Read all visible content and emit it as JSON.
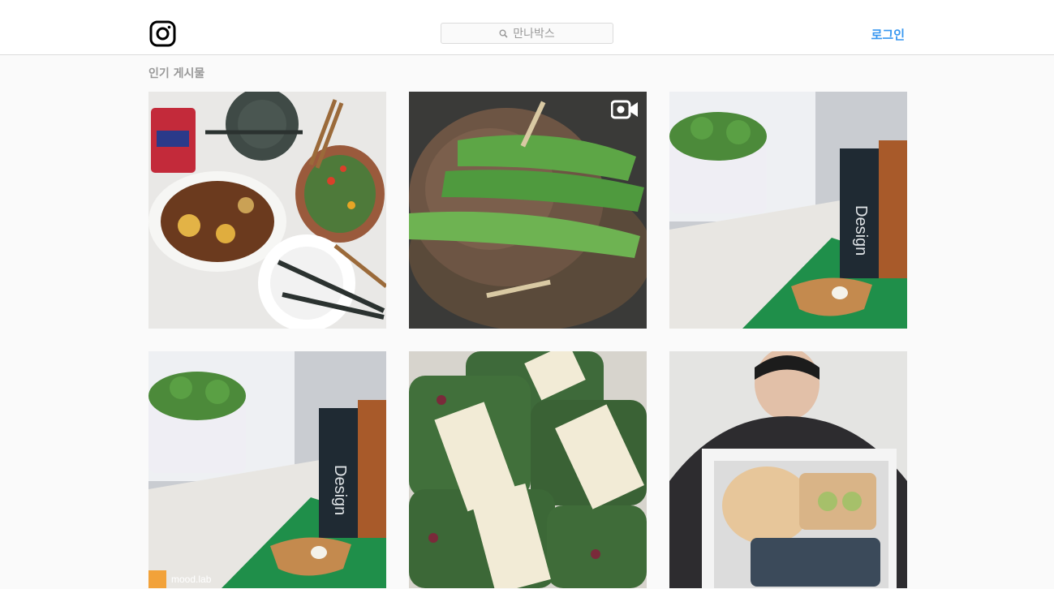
{
  "header": {
    "logo_icon": "instagram-camera-icon",
    "search_placeholder": "만나박스",
    "login_label": "로그인"
  },
  "main": {
    "section_title": "인기 게시물",
    "posts": [
      {
        "kind": "photo",
        "subject": "food-plates"
      },
      {
        "kind": "video",
        "subject": "steak-asparagus",
        "icon": "video-camera-icon"
      },
      {
        "kind": "photo",
        "subject": "planter-design-book"
      },
      {
        "kind": "photo",
        "subject": "planter-design-book",
        "badge": "mood.lab"
      },
      {
        "kind": "photo",
        "subject": "salad-boxes"
      },
      {
        "kind": "photo",
        "subject": "man-with-box"
      }
    ]
  },
  "colors": {
    "accent": "#3897f0",
    "background": "#fafafa",
    "border": "#dbdbdb"
  }
}
